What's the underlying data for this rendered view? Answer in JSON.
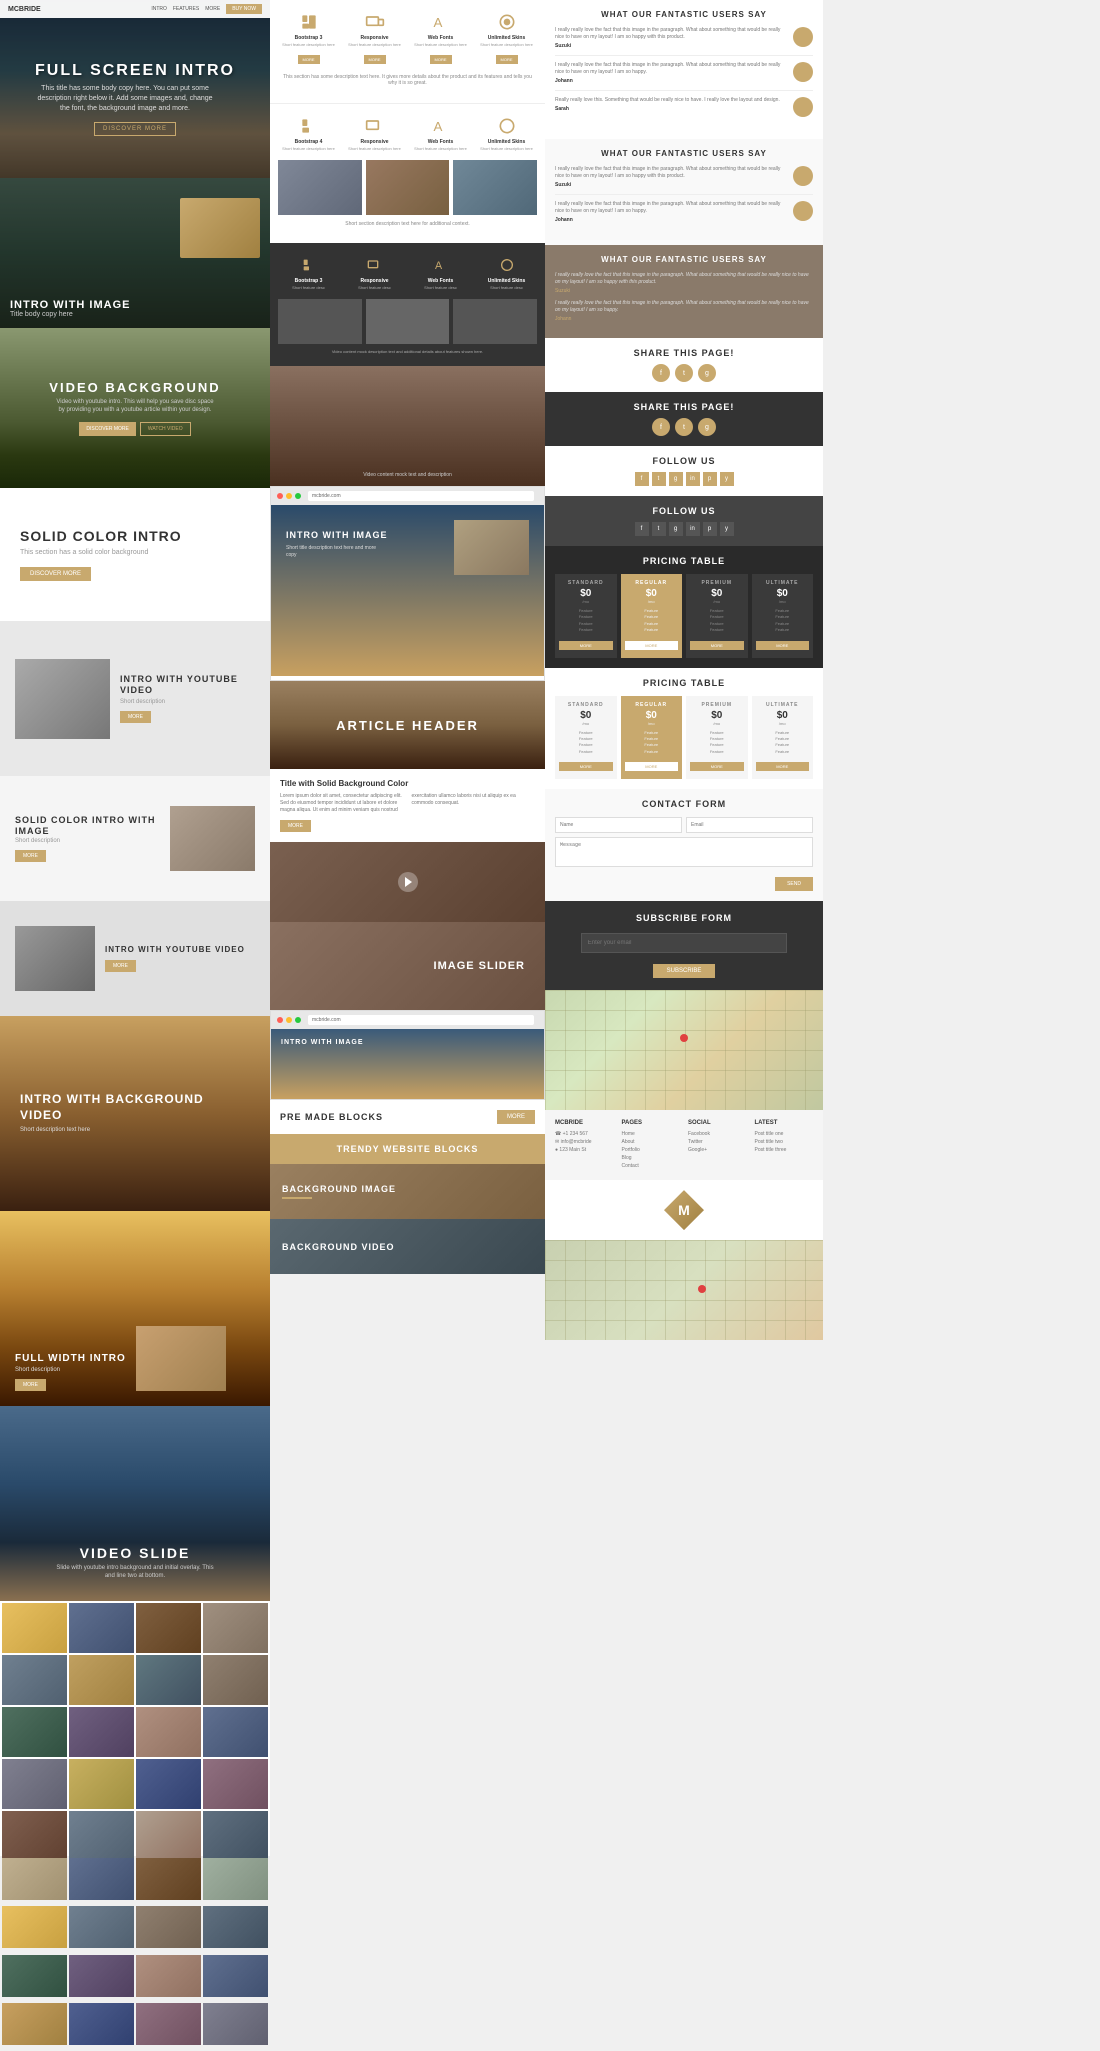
{
  "left": {
    "fullScreen": {
      "title": "FULL SCREEN INTRO",
      "subtitle": "This title has some body copy here. You can put some description right below it. Add some images and, change the font, the background image and more.",
      "btnLabel": "DISCOVER MORE"
    },
    "introImage": {
      "label": "INTRO WITH IMAGE",
      "sub": "Title body copy here"
    },
    "videoBg": {
      "title": "VIDEO BACKGROUND",
      "subtitle": "Video with youtube intro. This will help you save disc space by providing you with a youtube article within your design.",
      "btn1": "DISCOVER MORE",
      "btn2": "WATCH VIDEO"
    },
    "solidColor": {
      "title": "SOLID COLOR INTRO",
      "sub": "This section has a solid color background",
      "btn": "DISCOVER MORE"
    },
    "solidYoutube": {
      "label": "INTRO WITH YOUTUBE VIDEO",
      "sub": "Short description",
      "btn": "MORE"
    },
    "solidColorImage": {
      "label": "SOLID COLOR INTRO WITH IMAGE",
      "sub": "Short description",
      "btn": "MORE"
    },
    "introYoutube2": {
      "label": "INTRO WITH YOUTUBE VIDEO",
      "btn": "MORE"
    },
    "introBgVideo": {
      "label": "INTRO WITH BACKGROUND VIDEO",
      "sub": "Short description text here"
    },
    "fullWidth": {
      "label": "FULL WIDTH INTRO",
      "sub": "Short description",
      "btn": "MORE"
    },
    "videoSlide": {
      "title": "VIDEO SLIDE",
      "sub": "Slide with youtube intro background and initial overlay. This and line two at bottom."
    }
  },
  "mid": {
    "features1": {
      "items": [
        {
          "title": "Bootstrap 3",
          "desc": "Short feature description here goes here for this item"
        },
        {
          "title": "Responsive",
          "desc": "Short feature description here goes for this item"
        },
        {
          "title": "Web Fonts",
          "desc": "Short feature description here for this item"
        },
        {
          "title": "Unlimited Skins",
          "desc": "Short feature description here for this item"
        }
      ],
      "desc": "This section has some description text here. It gives more details about the product and its features and tells you why it is so great.",
      "btnLabel": "MORE"
    },
    "articleHeader": {
      "title": "ARTICLE HEADER"
    },
    "articleContentTitle": "Title with Solid Background Color",
    "articleText": "Lorem ipsum dolor sit amet, consectetur adipiscing elit. Sed do eiusmod tempor incididunt ut labore et dolore magna aliqua. Ut enim ad minim veniam quis nostrud exercitation ullamco laboris nisi ut aliquip ex ea commodo consequat.",
    "articleBtn": "MORE",
    "imageSlider": {
      "label": "IMAGE SLIDER"
    },
    "preMade": {
      "label": "PRE MADE BLOCKS",
      "btn": "MORE"
    },
    "trendy": {
      "label": "TRENDY WEBSITE BLOCKS"
    },
    "bgImage": {
      "label": "BACKGROUND IMAGE"
    },
    "bgVideo": {
      "label": "BACKGROUND VIDEO"
    }
  },
  "right": {
    "usersSay": {
      "title": "WHAT OUR FANTASTIC USERS SAY",
      "testimonials": [
        {
          "text": "I really really love the fact that this image in the paragraph. What about something that would be really nice to have on my layout! I am so happy with this product.",
          "author": "Suzuki"
        },
        {
          "text": "I really really love the fact that this image in the paragraph. What about something that would be really nice to have on my layout! I am so happy.",
          "author": "Johann"
        },
        {
          "text": "Really really love this. Something that would be really nice to have. I really love the layout and design.",
          "author": "Sarah"
        }
      ]
    },
    "sharePage": {
      "title": "SHARE THIS PAGE!"
    },
    "followUs": {
      "title": "FOLLOW US"
    },
    "pricingTable": {
      "title": "PRICING TABLE",
      "plans": [
        {
          "name": "STANDARD",
          "price": "$0",
          "period": "/mo",
          "features": "Feature\nFeature\nFeature\nFeature",
          "btn": "MORE",
          "featured": false
        },
        {
          "name": "REGULAR",
          "price": "$0",
          "period": "/mo",
          "features": "Feature\nFeature\nFeature\nFeature",
          "btn": "MORE",
          "featured": true
        },
        {
          "name": "PREMIUM",
          "price": "$0",
          "period": "/mo",
          "features": "Feature\nFeature\nFeature\nFeature",
          "btn": "MORE",
          "featured": false
        },
        {
          "name": "ULTIMATE",
          "price": "$0",
          "period": "/mo",
          "features": "Feature\nFeature\nFeature\nFeature",
          "btn": "MORE",
          "featured": false
        }
      ]
    },
    "contactForm": {
      "title": "CONTACT FORM",
      "namePlaceholder": "Name",
      "emailPlaceholder": "Email",
      "msgPlaceholder": "Message",
      "btn": "SEND"
    },
    "subscribe": {
      "title": "SUBSCRIBE FORM",
      "inputPlaceholder": "Enter your email",
      "btn": "SUBSCRIBE"
    }
  },
  "icons": {
    "bootstrap": "&#xe000;",
    "responsive": "&#xe001;",
    "webfonts": "&#x41;",
    "skins": "&#x42;",
    "share_fb": "f",
    "share_tw": "t",
    "share_gp": "g+"
  }
}
